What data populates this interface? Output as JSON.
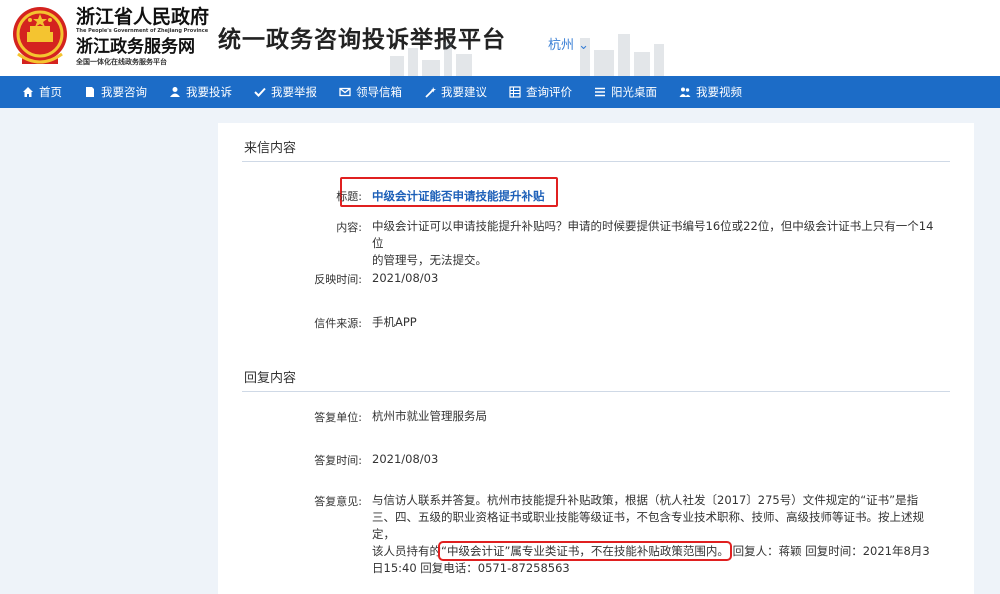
{
  "header": {
    "gov_title": "浙江省人民政府",
    "gov_title_en": "The People's Government of Zhejiang Province",
    "service_title": "浙江政务服务网",
    "service_sub": "全国一体化在线政务服务平台",
    "platform_title": "统一政务咨询投诉举报平台",
    "city": "杭州 ⌄"
  },
  "nav": [
    {
      "label": "首页",
      "icon": "home-icon"
    },
    {
      "label": "我要咨询",
      "icon": "document-icon"
    },
    {
      "label": "我要投诉",
      "icon": "user-icon"
    },
    {
      "label": "我要举报",
      "icon": "check-icon"
    },
    {
      "label": "领导信箱",
      "icon": "mail-icon"
    },
    {
      "label": "我要建议",
      "icon": "wand-icon"
    },
    {
      "label": "查询评价",
      "icon": "grid-icon"
    },
    {
      "label": "阳光桌面",
      "icon": "list-icon"
    },
    {
      "label": "我要视频",
      "icon": "people-icon"
    }
  ],
  "letter": {
    "section_title": "来信内容",
    "title_label": "标题:",
    "title_value": "中级会计证能否申请技能提升补贴",
    "content_label": "内容:",
    "content_line1": "中级会计证可以申请技能提升补贴吗？申请的时候要提供证书编号16位或22位，但中级会计证书上只有一个14位",
    "content_line2": "的管理号，无法提交。",
    "time_label": "反映时间:",
    "time_value": "2021/08/03",
    "source_label": "信件来源:",
    "source_value": "手机APP"
  },
  "reply": {
    "section_title": "回复内容",
    "unit_label": "答复单位:",
    "unit_value": "杭州市就业管理服务局",
    "time_label": "答复时间:",
    "time_value": "2021/08/03",
    "opinion_label": "答复意见:",
    "opinion_line1": "与信访人联系并答复。杭州市技能提升补贴政策，根据（杭人社发〔2017〕275号）文件规定的“证书”是指",
    "opinion_line2": "三、四、五级的职业资格证书或职业技能等级证书，不包含专业技术职称、技师、高级技师等证书。按上述规定，",
    "opinion_line3_pre": "该人员持有的",
    "opinion_line3_hl": "“中级会计证”属专业类证书，不在技能补贴政策范围内。",
    "opinion_line3_post": " 回复人：蒋颖 回复时间：2021年8月3",
    "opinion_line4": "日15:40 回复电话：0571-87258563"
  },
  "colors": {
    "nav_bg": "#1c6cc7",
    "highlight": "#e02020",
    "link": "#1c5fb8"
  }
}
